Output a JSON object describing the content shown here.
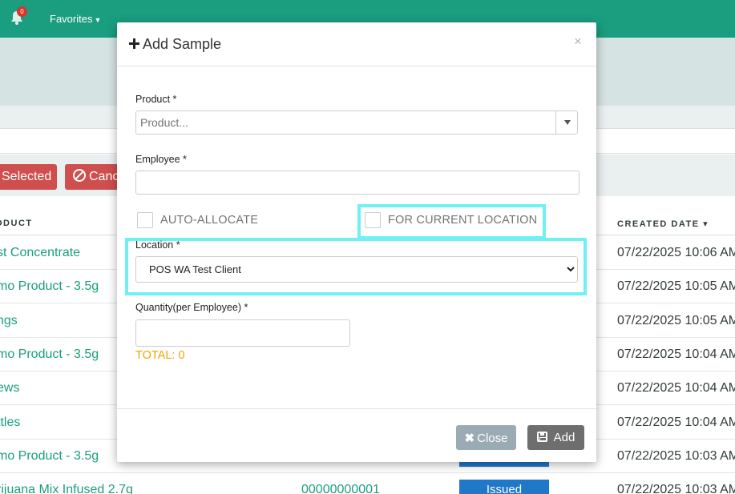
{
  "topbar": {
    "notification_count": "0",
    "favorites_label": "Favorites",
    "color": "#1a9e7f"
  },
  "toolbar": {
    "selected_label": "Selected",
    "cancel_label": "Canc"
  },
  "table": {
    "headers": {
      "product": "ODUCT",
      "created_date": "CREATED DATE ▾"
    },
    "rows": [
      {
        "product": "st Concentrate",
        "code": "",
        "status": "",
        "date": "07/22/2025 10:06 AM"
      },
      {
        "product": "mo Product - 3.5g",
        "code": "",
        "status": "",
        "date": "07/22/2025 10:05 AM"
      },
      {
        "product": "ngs",
        "code": "",
        "status": "",
        "date": "07/22/2025 10:05 AM"
      },
      {
        "product": "mo Product - 3.5g",
        "code": "",
        "status": "",
        "date": "07/22/2025 10:04 AM"
      },
      {
        "product": "ews",
        "code": "",
        "status": "",
        "date": "07/22/2025 10:04 AM"
      },
      {
        "product": "ttles",
        "code": "",
        "status": "",
        "date": "07/22/2025 10:04 AM"
      },
      {
        "product": "mo Product - 3.5g",
        "code": "",
        "status": "",
        "date": "07/22/2025 10:03 AM"
      },
      {
        "product": "rijuana Mix Infused 2.7g",
        "code": "00000000001",
        "status": "Issued",
        "date": "07/22/2025 10:03 AM"
      }
    ]
  },
  "modal": {
    "title": "Add Sample",
    "close_x": "×",
    "product": {
      "label": "Product *",
      "placeholder": "Product..."
    },
    "employee": {
      "label": "Employee *",
      "value": ""
    },
    "auto_allocate_label": "AUTO-ALLOCATE",
    "for_current_location_label": "FOR CURRENT LOCATION",
    "location": {
      "label": "Location *",
      "selected": "POS WA Test Client"
    },
    "quantity": {
      "label": "Quantity(per Employee) *",
      "value": ""
    },
    "total_text": "TOTAL: 0",
    "close_button": "Close",
    "add_button": "Add",
    "highlight_color": "#6ff0f5",
    "total_color": "#f0a500"
  }
}
